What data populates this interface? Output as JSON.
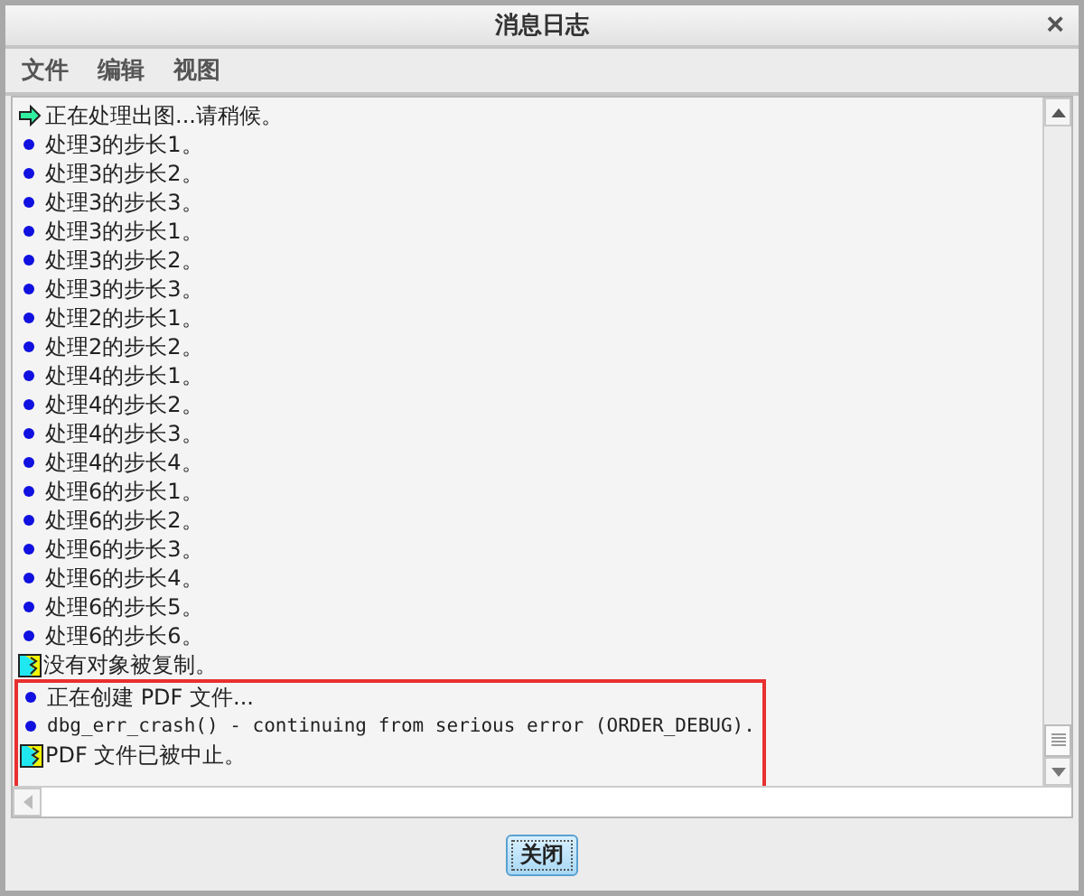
{
  "window": {
    "title": "消息日志",
    "close": "×"
  },
  "menu": [
    "文件",
    "编辑",
    "视图"
  ],
  "log": [
    {
      "kind": "arrow",
      "text": "正在处理出图...请稍候。",
      "highlighted": false
    },
    {
      "kind": "bullet",
      "text": "处理3的步长1。",
      "highlighted": false
    },
    {
      "kind": "bullet",
      "text": "处理3的步长2。",
      "highlighted": false
    },
    {
      "kind": "bullet",
      "text": "处理3的步长3。",
      "highlighted": false
    },
    {
      "kind": "bullet",
      "text": "处理3的步长1。",
      "highlighted": false
    },
    {
      "kind": "bullet",
      "text": "处理3的步长2。",
      "highlighted": false
    },
    {
      "kind": "bullet",
      "text": "处理3的步长3。",
      "highlighted": false
    },
    {
      "kind": "bullet",
      "text": "处理2的步长1。",
      "highlighted": false
    },
    {
      "kind": "bullet",
      "text": "处理2的步长2。",
      "highlighted": false
    },
    {
      "kind": "bullet",
      "text": "处理4的步长1。",
      "highlighted": false
    },
    {
      "kind": "bullet",
      "text": "处理4的步长2。",
      "highlighted": false
    },
    {
      "kind": "bullet",
      "text": "处理4的步长3。",
      "highlighted": false
    },
    {
      "kind": "bullet",
      "text": "处理4的步长4。",
      "highlighted": false
    },
    {
      "kind": "bullet",
      "text": "处理6的步长1。",
      "highlighted": false
    },
    {
      "kind": "bullet",
      "text": "处理6的步长2。",
      "highlighted": false
    },
    {
      "kind": "bullet",
      "text": "处理6的步长3。",
      "highlighted": false
    },
    {
      "kind": "bullet",
      "text": "处理6的步长4。",
      "highlighted": false
    },
    {
      "kind": "bullet",
      "text": "处理6的步长5。",
      "highlighted": false
    },
    {
      "kind": "bullet",
      "text": "处理6的步长6。",
      "highlighted": false
    },
    {
      "kind": "warning",
      "text": "没有对象被复制。",
      "highlighted": false
    },
    {
      "kind": "bullet",
      "text": "正在创建 PDF 文件...",
      "highlighted": true
    },
    {
      "kind": "bullet",
      "text": " dbg_err_crash() - continuing from serious error (ORDER_DEBUG).",
      "highlighted": true
    },
    {
      "kind": "warning",
      "text": "PDF 文件已被中止。",
      "highlighted": true
    }
  ],
  "buttons": [
    "关闭"
  ]
}
